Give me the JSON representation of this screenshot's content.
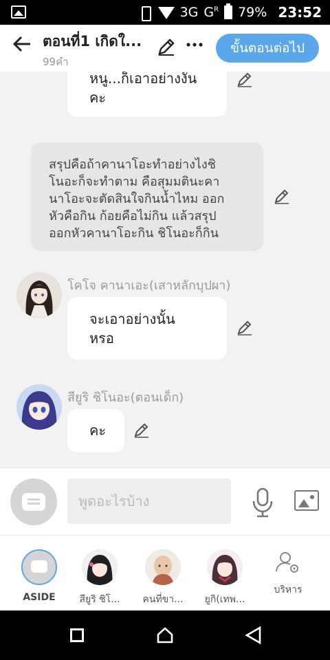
{
  "status_bar": {
    "network": "3G",
    "network2": "G",
    "roaming": "R",
    "battery": "79%",
    "time": "23:52",
    "icons": [
      "gallery-icon",
      "vibrate-icon",
      "wifi-icon",
      "signal-icon",
      "battery-icon"
    ]
  },
  "header": {
    "back_icon": "←",
    "title": "ตอนที่1 เกิดใ...",
    "subtitle": "99คำ",
    "edit_icon": "✎",
    "more_icon": "•••",
    "next_label": "ขั้นตอนต่อไป"
  },
  "messages": [
    {
      "type": "dialogue",
      "speaker": "",
      "text_lines": [
        "หนู...ก็เอาอย่างงั้น",
        "คะ"
      ]
    },
    {
      "type": "narration",
      "text_lines": [
        "สรุปคือถ้าคานาโอะทำอย่างไงชิ",
        "โนอะก็จะทำตาม คือสุมมตินะคา",
        "นาโอะจะตัดสินใจกินน้ำไหม ออก",
        "หัวคือกิน ก้อยคือไม่กิน แล้วสรุป",
        "ออกหัวคานาโอะกิน ชิโนอะก็กิน"
      ]
    },
    {
      "type": "dialogue",
      "speaker": "โคโจ คานาเอะ(เสาหลักบุปผา)",
      "text_lines": [
        "จะเอาอย่างนั้น",
        "หรอ"
      ]
    },
    {
      "type": "dialogue",
      "speaker": "สียูริ ชิโนอะ(ตอนเด็ก)",
      "text_lines": [
        "คะ"
      ]
    }
  ],
  "input": {
    "placeholder": "พูดอะไรบ้าง",
    "mic_icon": "mic-icon",
    "image_icon": "image-icon"
  },
  "characters": [
    {
      "label": "ASIDE",
      "active": true
    },
    {
      "label": "สียูริ ชิโ...",
      "active": false
    },
    {
      "label": "คนที่ขา...",
      "active": false
    },
    {
      "label": "ยูกิ(เทพ...",
      "active": false
    },
    {
      "label": "บริหาร",
      "active": false
    }
  ],
  "colors": {
    "accent": "#5aa7ec",
    "bubble": "#ffffff",
    "narration": "#e6e6e6",
    "background": "#f2f2f2"
  }
}
